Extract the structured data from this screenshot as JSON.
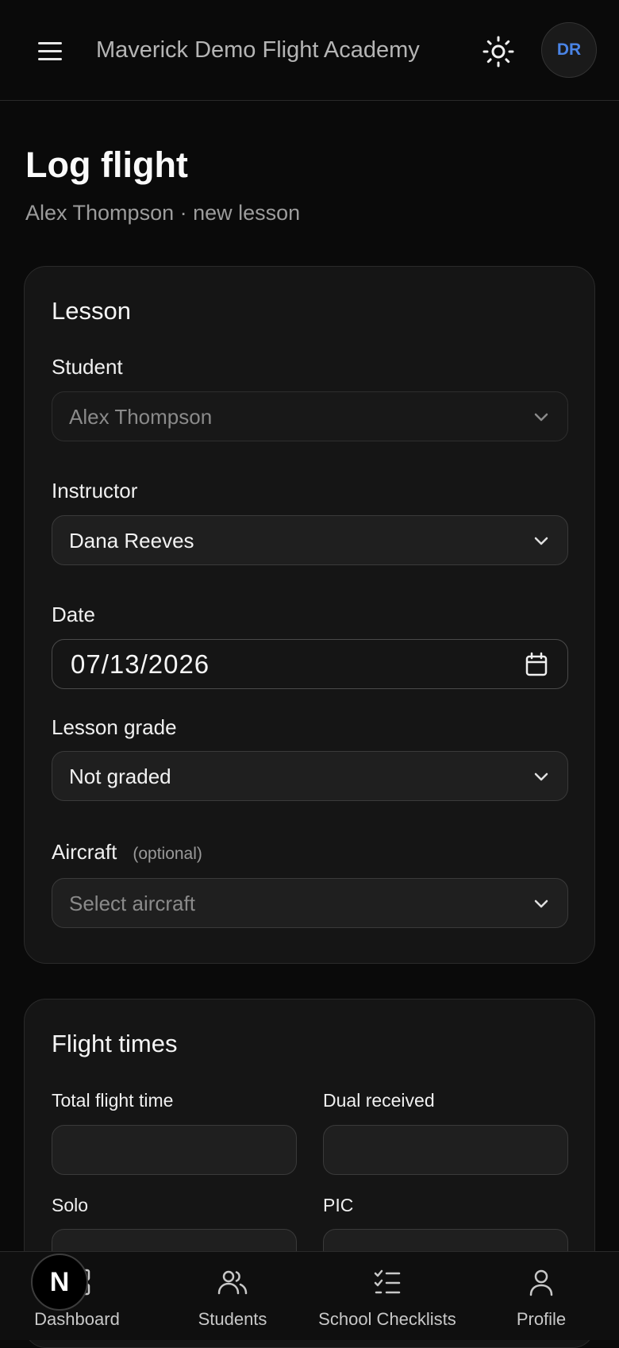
{
  "header": {
    "app_title": "Maverick Demo Flight Academy",
    "avatar_initials": "DR",
    "menu_icon": "hamburger-menu-icon",
    "theme_icon": "sun-icon"
  },
  "page": {
    "title": "Log flight",
    "subtitle": "Alex Thompson · new lesson"
  },
  "lesson_card": {
    "title": "Lesson",
    "student": {
      "label": "Student",
      "value": "Alex Thompson"
    },
    "instructor": {
      "label": "Instructor",
      "value": "Dana Reeves"
    },
    "date": {
      "label": "Date",
      "value": "07/13/2026"
    },
    "grade": {
      "label": "Lesson grade",
      "value": "Not graded"
    },
    "aircraft": {
      "label": "Aircraft",
      "optional": "(optional)",
      "placeholder": "Select aircraft"
    }
  },
  "flight_times_card": {
    "title": "Flight times",
    "total": {
      "label": "Total flight time"
    },
    "dual": {
      "label": "Dual received"
    },
    "solo": {
      "label": "Solo"
    },
    "pic": {
      "label": "PIC"
    }
  },
  "nav": {
    "items": [
      {
        "label": "Dashboard",
        "icon": "dashboard-icon"
      },
      {
        "label": "Students",
        "icon": "students-icon"
      },
      {
        "label": "School Checklists",
        "icon": "checklist-icon"
      },
      {
        "label": "Profile",
        "icon": "profile-icon"
      }
    ],
    "badge_letter": "N"
  },
  "colors": {
    "background": "#0a0a0a",
    "card": "#151515",
    "accent": "#4a84e6"
  }
}
